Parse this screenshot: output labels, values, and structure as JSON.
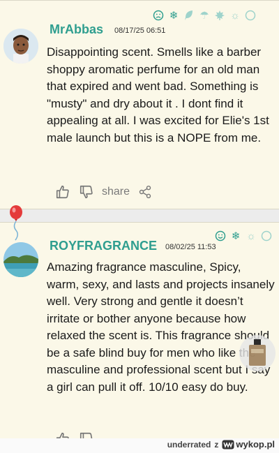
{
  "review1": {
    "username": "MrAbbas",
    "date": "08/17/25 06:51",
    "text": "Disappointing scent. Smells like a barber shoppy aromatic perfume for an old man that expired and went bad. Something is \"musty\" and dry about it . I dont find it appealing at all. I was excited for Elie's 1st male launch but this is a NOPE from me.",
    "icons": [
      "sad-face-icon",
      "snowflake-icon",
      "leaf-icon",
      "umbrella-icon",
      "maple-leaf-icon",
      "sun-icon",
      "night-icon"
    ],
    "share_label": "share"
  },
  "review2": {
    "username": "ROYFRAGRANCE",
    "date": "08/02/25 11:53",
    "text": "Amazing fragrance masculine, Spicy, warm, sexy, and lasts and projects insanely well. Very strong and gentle it doesn’t irritate or bother anyone because how relaxed the scent is. This fragrance should be a safe blind buy for men who like the masculine and professional scent but I say a girl can pull it off. 10/10 easy do buy.",
    "icons": [
      "smile-face-icon",
      "snowflake-icon",
      "sun-icon",
      "night-icon"
    ]
  },
  "watermark": {
    "user": "underrated",
    "separator": "z",
    "site": "wykop.pl"
  },
  "colors": {
    "accent": "#2f9e8f",
    "card_bg": "#fbf8e8"
  }
}
